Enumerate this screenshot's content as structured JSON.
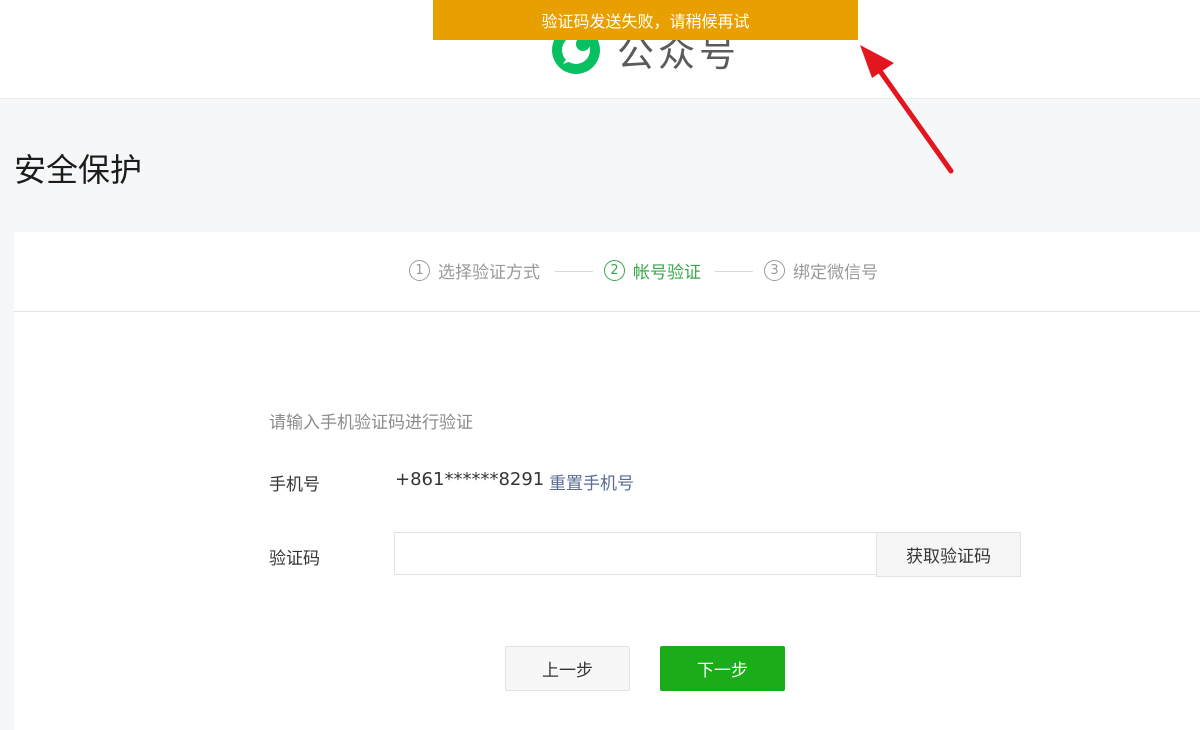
{
  "toast": {
    "message": "验证码发送失败，请稍候再试",
    "color": "#e8a000"
  },
  "header": {
    "brand_name": "公众号",
    "logo_icon": "wechat-official-account-logo"
  },
  "page": {
    "title": "安全保护"
  },
  "steps": [
    {
      "number": "1",
      "label": "选择验证方式",
      "state": "done"
    },
    {
      "number": "2",
      "label": "帐号验证",
      "state": "active"
    },
    {
      "number": "3",
      "label": "绑定微信号",
      "state": "pending"
    }
  ],
  "form": {
    "hint": "请输入手机验证码进行验证",
    "phone_label": "手机号",
    "phone_value": "+861******8291",
    "reset_phone_link": "重置手机号",
    "code_label": "验证码",
    "code_value": "",
    "code_placeholder": "",
    "get_code_button": "获取验证码"
  },
  "buttons": {
    "prev": "上一步",
    "next": "下一步"
  },
  "colors": {
    "accent_green": "#1aad19",
    "step_active": "#39a84a",
    "link": "#576b95",
    "arrow": "#e3151e"
  }
}
